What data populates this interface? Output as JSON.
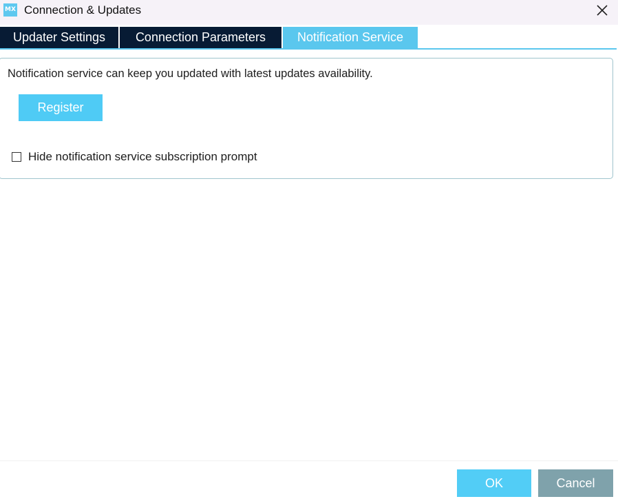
{
  "window": {
    "title": "Connection & Updates",
    "app_icon_text": "MX",
    "close_icon": "close-icon"
  },
  "tabs": [
    {
      "label": "Updater Settings",
      "active": false
    },
    {
      "label": "Connection Parameters",
      "active": false
    },
    {
      "label": "Notification Service",
      "active": true
    }
  ],
  "notification": {
    "description": "Notification service can keep you updated with latest updates availability.",
    "register_label": "Register",
    "hide_prompt_label": "Hide notification service subscription prompt",
    "hide_prompt_checked": false
  },
  "footer": {
    "ok_label": "OK",
    "cancel_label": "Cancel"
  },
  "colors": {
    "accent": "#5ac7ee",
    "tab_dark": "#071b34",
    "cancel": "#7fa2ab"
  }
}
